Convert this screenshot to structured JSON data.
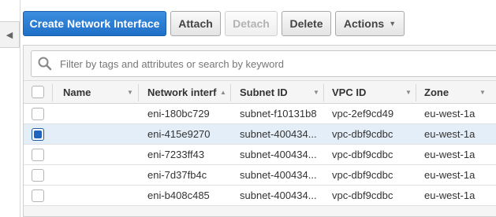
{
  "toolbar": {
    "create_label": "Create Network Interface",
    "attach_label": "Attach",
    "detach_label": "Detach",
    "delete_label": "Delete",
    "actions_label": "Actions"
  },
  "search": {
    "placeholder": "Filter by tags and attributes or search by keyword"
  },
  "table": {
    "columns": [
      {
        "label": "Name"
      },
      {
        "label": "Network interfa"
      },
      {
        "label": "Subnet ID"
      },
      {
        "label": "VPC ID"
      },
      {
        "label": "Zone"
      }
    ],
    "rows": [
      {
        "name": "",
        "eni": "eni-180bc729",
        "subnet": "subnet-f10131b8",
        "vpc": "vpc-2ef9cd49",
        "zone": "eu-west-1a",
        "selected": false
      },
      {
        "name": "",
        "eni": "eni-415e9270",
        "subnet": "subnet-400434...",
        "vpc": "vpc-dbf9cdbc",
        "zone": "eu-west-1a",
        "selected": true
      },
      {
        "name": "",
        "eni": "eni-7233ff43",
        "subnet": "subnet-400434...",
        "vpc": "vpc-dbf9cdbc",
        "zone": "eu-west-1a",
        "selected": false
      },
      {
        "name": "",
        "eni": "eni-7d37fb4c",
        "subnet": "subnet-400434...",
        "vpc": "vpc-dbf9cdbc",
        "zone": "eu-west-1a",
        "selected": false
      },
      {
        "name": "",
        "eni": "eni-b408c485",
        "subnet": "subnet-400434...",
        "vpc": "vpc-dbf9cdbc",
        "zone": "eu-west-1a",
        "selected": false
      }
    ]
  },
  "colors": {
    "primary": "#1f6fc7",
    "selected_row": "#e4eef8"
  }
}
